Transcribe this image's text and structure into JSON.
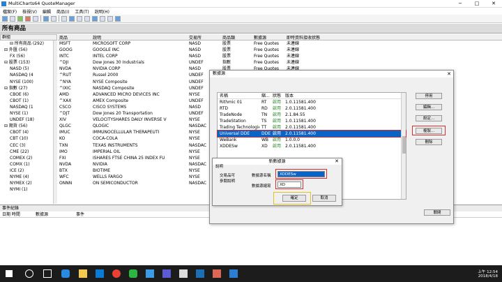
{
  "window": {
    "title": "MultiCharts64 QuoteManager",
    "min": "−",
    "max": "□",
    "close": "✕"
  },
  "menu": [
    "檔案(F)",
    "檢視(V)",
    "編輯",
    "商品(I)",
    "工具(T)",
    "說明(H)"
  ],
  "section_title": "所有商品",
  "tree": {
    "header": "群組",
    "items": [
      "⊟ 所有商品 (292)",
      "⊟ 外匯 (56)",
      "FX (56)",
      "⊟ 股票 (153)",
      "NASD (5)",
      "NASDAQ (4",
      "NYSE (100)",
      "⊟ 指數 (27)",
      "CBOE (6)",
      "CBOT (1)",
      "NASDAQ (1",
      "NYSE (1)",
      "UNDEF (18)",
      "⊟ 期貨 (56)",
      "CBOT (4)",
      "CBT (10)",
      "CEC (3)",
      "CME (22)",
      "COMEX (2)",
      "COMX (1)",
      "ICE (2)",
      "NYME (4)",
      "NYMEX (2)",
      "NYMI (1)"
    ]
  },
  "grid": {
    "headers": [
      "商品",
      "說明",
      "交易所",
      "商品類",
      "數據源",
      "即時資料接收狀態"
    ],
    "rows": [
      [
        "MSFT",
        "MICROSOFT CORP",
        "NASD",
        "股票",
        "Free Quotes",
        "未連線"
      ],
      [
        "GOOG",
        "GOOGLE INC",
        "NASD",
        "股票",
        "Free Quotes",
        "未連線"
      ],
      [
        "INTC",
        "INTEL CORP",
        "NASD",
        "股票",
        "Free Quotes",
        "未連線"
      ],
      [
        "^DJI",
        "Dow Jones 30 Industrials",
        "UNDEF",
        "指數",
        "Free Quotes",
        "未連線"
      ],
      [
        "NVDA",
        "NVIDIA CORP",
        "NASD",
        "股票",
        "Free Quotes",
        "未連線"
      ],
      [
        "^RUT",
        "Russel 2000",
        "UNDEF",
        "",
        "",
        ""
      ],
      [
        "^NYA",
        "NYSE Composite",
        "UNDEF",
        "",
        "",
        ""
      ],
      [
        "^IXIC",
        "NASDAQ Composite",
        "UNDEF",
        "",
        "",
        ""
      ],
      [
        "AMD",
        "ADVANCED MICRO DEVICES INC",
        "NYSE",
        "",
        "",
        ""
      ],
      [
        "^XAX",
        "AMEX Composite",
        "UNDEF",
        "",
        "",
        ""
      ],
      [
        "CSCO",
        "CISCO SYSTEMS",
        "NASD",
        "",
        "",
        ""
      ],
      [
        "^DJT",
        "Dow Jones 20 Transportation",
        "UNDEF",
        "",
        "",
        ""
      ],
      [
        "XIV",
        "VELOCITYSHARES DAILY INVERSE V",
        "NYSE",
        "",
        "",
        ""
      ],
      [
        "QLGC",
        "QLOGIC",
        "NASDAC",
        "",
        "",
        ""
      ],
      [
        "IMUC",
        "IMMUNOCELLULAR THERAPEUTI",
        "NYSE",
        "",
        "",
        ""
      ],
      [
        "KO",
        "COCA-COLA",
        "NYSE",
        "",
        "",
        ""
      ],
      [
        "TXN",
        "TEXAS INSTRUMENTS",
        "NASDAC",
        "",
        "",
        ""
      ],
      [
        "IMO",
        "IMPERIAL OIL",
        "NYSE",
        "",
        "",
        ""
      ],
      [
        "FXI",
        "ISHARES FTSE CHINA 25 INDEX FU",
        "NYSE",
        "",
        "",
        ""
      ],
      [
        "NVDA",
        "NVIDIA",
        "NASDAC",
        "",
        "",
        ""
      ],
      [
        "BTX",
        "BIOTIME",
        "NYSE",
        "",
        "",
        ""
      ],
      [
        "WFC",
        "WELLS FARGO",
        "NYSE",
        "",
        "",
        ""
      ],
      [
        "ONNN",
        "ON SEMICONDUCTOR",
        "NASDAC",
        "",
        "",
        ""
      ]
    ]
  },
  "events": {
    "title": "事件紀錄",
    "cols": [
      "日期 時間",
      "數據源",
      "事件"
    ]
  },
  "dialog": {
    "title": "數據源",
    "close": "✕",
    "headers": [
      "名稱",
      "縮...",
      "狀態",
      "版本"
    ],
    "rows": [
      [
        "Rithmic 01",
        "RT",
        "啟用",
        "1.0.11581.400"
      ],
      [
        "RTD",
        "RD",
        "啟用",
        "2.0.11581.400"
      ],
      [
        "TradeNode",
        "TN",
        "啟用",
        "2.1.84.55"
      ],
      [
        "TradeStation",
        "TS",
        "啟用",
        "1.0.11581.400"
      ],
      [
        "Trading Technologies",
        "TT",
        "啟用",
        "2.0.11581.400"
      ],
      [
        "Universal DDE",
        "DDE",
        "啟用",
        "2.0.11581.400"
      ],
      [
        "WeBank",
        "WB",
        "啟用",
        "1.0.0.0"
      ],
      [
        "XDDESw",
        "XD",
        "啟用",
        "2.0.11581.400"
      ]
    ],
    "buttons": [
      "停用",
      "編輯...",
      "設定...",
      "複製...",
      "刪除",
      "關閉"
    ]
  },
  "subdialog": {
    "title": "新數據源",
    "close": "✕",
    "desc_label": "說明",
    "left_text1": "交易品可",
    "left_text2": "參閱說明",
    "name_label": "數據源名稱",
    "name_value": "XDDESw",
    "abbr_label": "數據源縮寫",
    "abbr_value": "XD",
    "ok": "確定",
    "cancel": "取消"
  },
  "tray": {
    "time": "上午 12:54",
    "date": "2018/4/18"
  }
}
